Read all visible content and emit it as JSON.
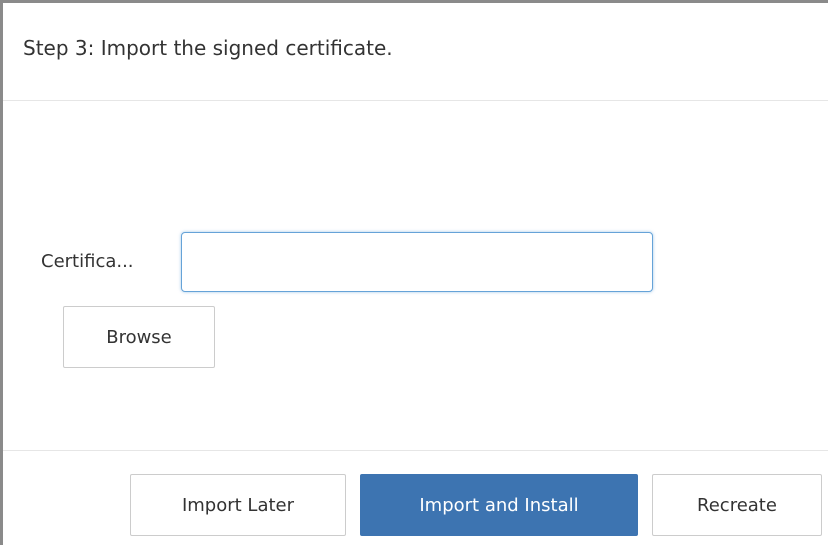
{
  "dialog": {
    "title": "Step 3: Import the signed certificate."
  },
  "form": {
    "certificate_label": "Certifica...",
    "certificate_value": "",
    "browse_label": "Browse"
  },
  "footer": {
    "import_later_label": "Import Later",
    "import_install_label": "Import and Install",
    "recreate_label": "Recreate"
  },
  "colors": {
    "primary": "#3d74b1",
    "focus_border": "#66a3d8",
    "dialog_border": "#8a8a8a"
  }
}
